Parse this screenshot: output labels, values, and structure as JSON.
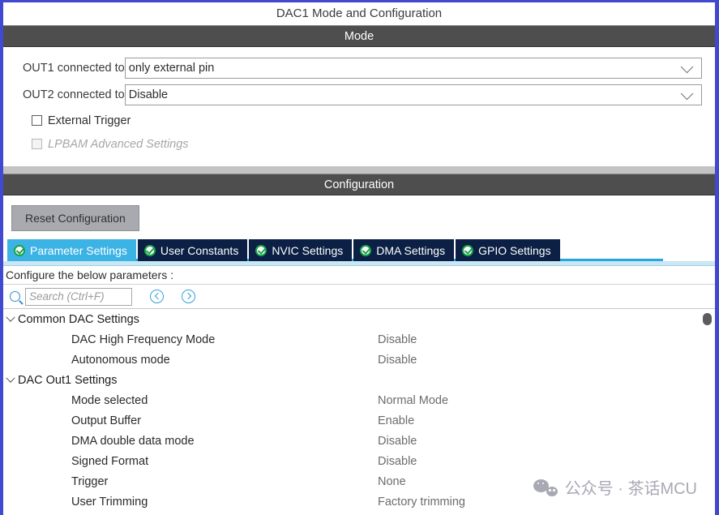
{
  "panel": {
    "title": "DAC1 Mode and Configuration"
  },
  "mode_section": {
    "header": "Mode",
    "fields": [
      {
        "label": "OUT1 connected to",
        "value": "only external pin"
      },
      {
        "label": "OUT2 connected to",
        "value": "Disable"
      }
    ],
    "checkboxes": [
      {
        "label": "External Trigger",
        "checked": false,
        "disabled": false
      },
      {
        "label": "LPBAM Advanced Settings",
        "checked": false,
        "disabled": true
      }
    ]
  },
  "configuration_section": {
    "header": "Configuration",
    "reset_button": "Reset Configuration",
    "tabs": [
      {
        "label": "Parameter Settings",
        "active": true
      },
      {
        "label": "User Constants",
        "active": false
      },
      {
        "label": "NVIC Settings",
        "active": false
      },
      {
        "label": "DMA Settings",
        "active": false
      },
      {
        "label": "GPIO Settings",
        "active": false
      }
    ],
    "configure_label": "Configure the below parameters :",
    "search": {
      "placeholder": "Search (Ctrl+F)",
      "value": ""
    },
    "groups": [
      {
        "name": "Common DAC Settings",
        "expanded": true,
        "params": [
          {
            "name": "DAC High Frequency Mode",
            "value": "Disable"
          },
          {
            "name": "Autonomous mode",
            "value": "Disable"
          }
        ]
      },
      {
        "name": "DAC Out1 Settings",
        "expanded": true,
        "params": [
          {
            "name": "Mode selected",
            "value": "Normal Mode"
          },
          {
            "name": "Output Buffer",
            "value": "Enable"
          },
          {
            "name": "DMA double data mode",
            "value": "Disable"
          },
          {
            "name": "Signed Format",
            "value": "Disable"
          },
          {
            "name": "Trigger",
            "value": "None"
          },
          {
            "name": "User Trimming",
            "value": "Factory trimming"
          }
        ]
      }
    ]
  },
  "watermark": {
    "text": "公众号 · 茶话MCU"
  },
  "colors": {
    "frame_border": "#4149cf",
    "section_bar": "#4e4e4e",
    "tab_active": "#3cb3e5",
    "tab_inactive": "#0b2044",
    "tick_green": "#19a349",
    "accent_blue": "#27a5dd",
    "reset_button": "#a9a9b0"
  }
}
